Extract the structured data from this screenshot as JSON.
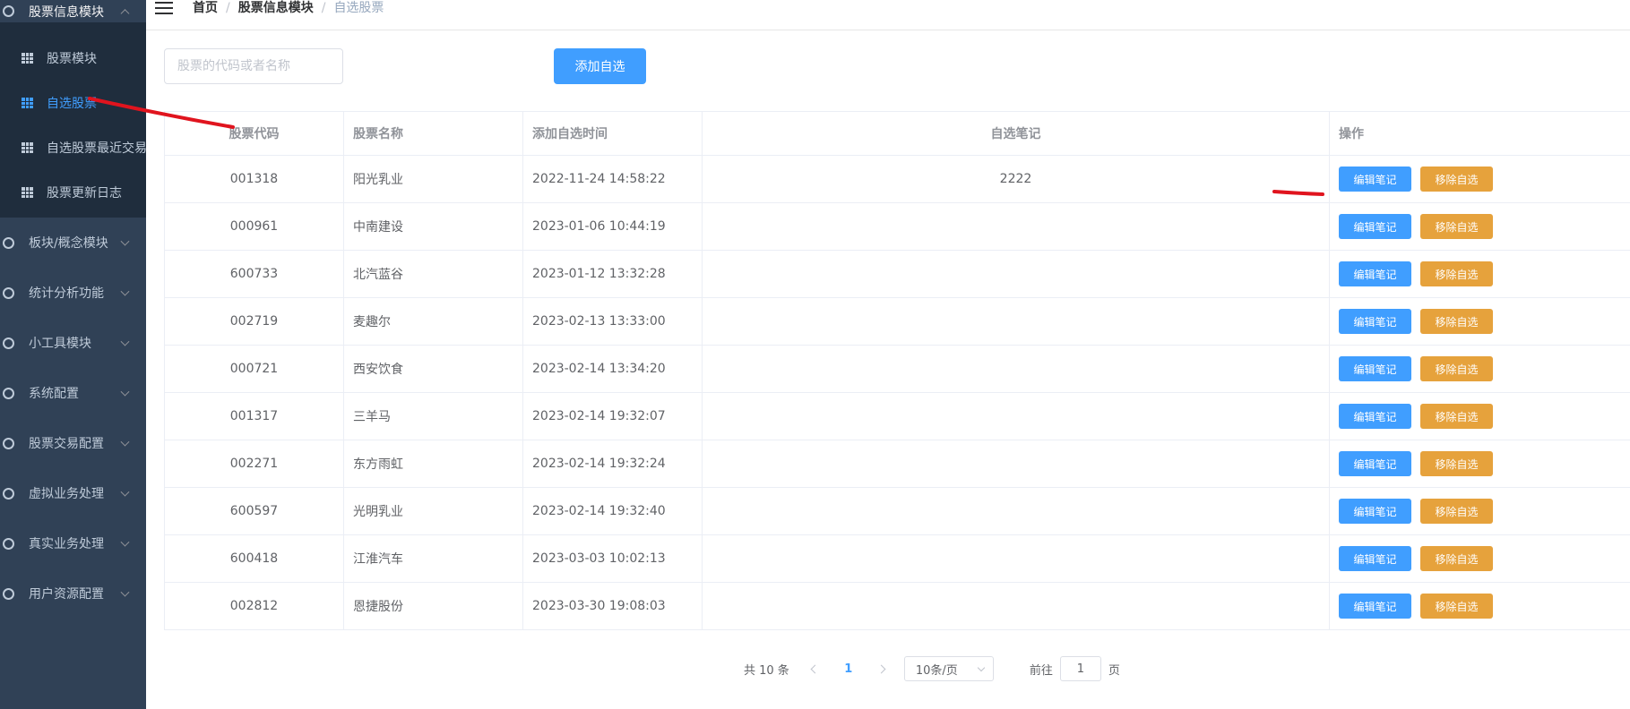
{
  "sidebar": {
    "top_menu": "股票信息模块",
    "submenu": [
      {
        "label": "股票模块",
        "active": false
      },
      {
        "label": "自选股票",
        "active": true
      },
      {
        "label": "自选股票最近交易",
        "active": false
      },
      {
        "label": "股票更新日志",
        "active": false
      }
    ],
    "menus": [
      "板块/概念模块",
      "统计分析功能",
      "小工具模块",
      "系统配置",
      "股票交易配置",
      "虚拟业务处理",
      "真实业务处理",
      "用户资源配置"
    ]
  },
  "breadcrumb": [
    "首页",
    "股票信息模块",
    "自选股票"
  ],
  "search": {
    "placeholder": "股票的代码或者名称",
    "value": "",
    "add_label": "添加自选"
  },
  "table": {
    "headers": [
      "股票代码",
      "股票名称",
      "添加自选时间",
      "自选笔记",
      "操作"
    ],
    "edit_label": "编辑笔记",
    "remove_label": "移除自选",
    "rows": [
      {
        "code": "001318",
        "name": "阳光乳业",
        "time": "2022-11-24 14:58:22",
        "note": "2222"
      },
      {
        "code": "000961",
        "name": "中南建设",
        "time": "2023-01-06 10:44:19",
        "note": ""
      },
      {
        "code": "600733",
        "name": "北汽蓝谷",
        "time": "2023-01-12 13:32:28",
        "note": ""
      },
      {
        "code": "002719",
        "name": "麦趣尔",
        "time": "2023-02-13 13:33:00",
        "note": ""
      },
      {
        "code": "000721",
        "name": "西安饮食",
        "time": "2023-02-14 13:34:20",
        "note": ""
      },
      {
        "code": "001317",
        "name": "三羊马",
        "time": "2023-02-14 19:32:07",
        "note": ""
      },
      {
        "code": "002271",
        "name": "东方雨虹",
        "time": "2023-02-14 19:32:24",
        "note": ""
      },
      {
        "code": "600597",
        "name": "光明乳业",
        "time": "2023-02-14 19:32:40",
        "note": ""
      },
      {
        "code": "600418",
        "name": "江淮汽车",
        "time": "2023-03-03 10:02:13",
        "note": ""
      },
      {
        "code": "002812",
        "name": "恩捷股份",
        "time": "2023-03-30 19:08:03",
        "note": ""
      }
    ]
  },
  "pagination": {
    "total": "共 10 条",
    "current": "1",
    "page_size": "10条/页",
    "goto_prefix": "前往",
    "goto_value": "1",
    "goto_suffix": "页"
  },
  "colors": {
    "primary": "#409eff",
    "warning": "#e6a23c",
    "sidebar_bg": "#304156",
    "submenu_bg": "#1f2d3d",
    "annotation": "#e0141e"
  }
}
